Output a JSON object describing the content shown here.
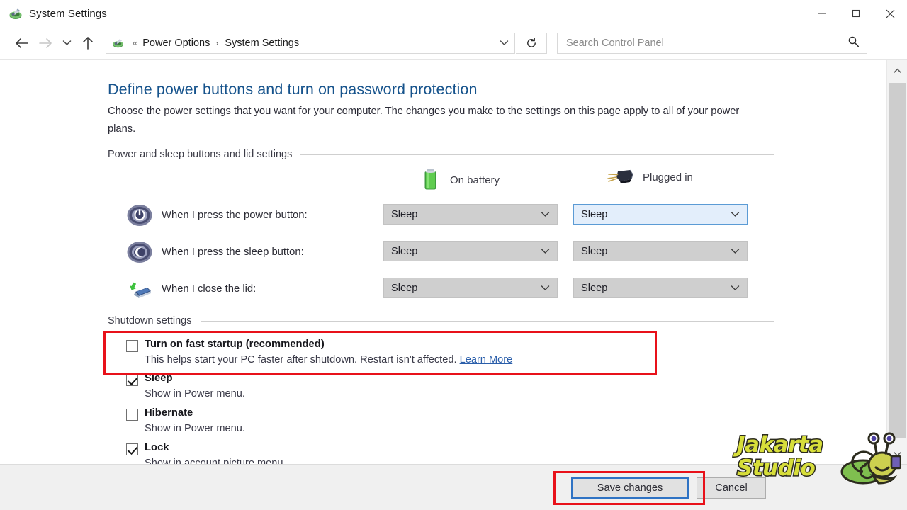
{
  "window": {
    "title": "System Settings",
    "icon": "power-options-icon",
    "controls": {
      "minimize": "minimize-icon",
      "maximize": "maximize-icon",
      "close": "close-icon"
    }
  },
  "navbar": {
    "back": "back-arrow-icon",
    "forward": "forward-arrow-icon",
    "history": "recent-locations-icon",
    "up": "up-arrow-icon",
    "address_icon": "power-options-icon",
    "overflow": "«",
    "breadcrumbs": [
      "Power Options",
      "System Settings"
    ],
    "separator": "›",
    "dropdown": "chevron-down-icon",
    "refresh": "refresh-icon",
    "search": {
      "placeholder": "Search Control Panel",
      "value": "",
      "icon": "search-icon"
    }
  },
  "page": {
    "title": "Define power buttons and turn on password protection",
    "description": "Choose the power settings that you want for your computer. The changes you make to the settings on this page apply to all of your power plans."
  },
  "sections": {
    "power_buttons": {
      "header": "Power and sleep buttons and lid settings",
      "columns": [
        {
          "label": "On battery",
          "icon": "battery-icon"
        },
        {
          "label": "Plugged in",
          "icon": "power-plug-icon"
        }
      ],
      "rows": [
        {
          "icon": "power-button-icon",
          "label": "When I press the power button:",
          "on_battery": "Sleep",
          "plugged_in": "Sleep",
          "plugged_in_focused": true
        },
        {
          "icon": "sleep-moon-icon",
          "label": "When I press the sleep button:",
          "on_battery": "Sleep",
          "plugged_in": "Sleep",
          "plugged_in_focused": false
        },
        {
          "icon": "laptop-lid-icon",
          "label": "When I close the lid:",
          "on_battery": "Sleep",
          "plugged_in": "Sleep",
          "plugged_in_focused": false
        }
      ]
    },
    "shutdown": {
      "header": "Shutdown settings",
      "items": [
        {
          "label": "Turn on fast startup (recommended)",
          "checked": false,
          "sub": "This helps start your PC faster after shutdown. Restart isn't affected. ",
          "link": "Learn More",
          "highlighted": true
        },
        {
          "label": "Sleep",
          "checked": true,
          "sub": "Show in Power menu.",
          "link": "",
          "highlighted": false
        },
        {
          "label": "Hibernate",
          "checked": false,
          "sub": "Show in Power menu.",
          "link": "",
          "highlighted": false
        },
        {
          "label": "Lock",
          "checked": true,
          "sub": "Show in account picture menu.",
          "link": "",
          "highlighted": false
        }
      ]
    }
  },
  "footer": {
    "save_label": "Save changes",
    "cancel_label": "Cancel",
    "save_highlighted": true
  },
  "scrollbar": {
    "up": "scroll-up-icon",
    "down": "scroll-down-icon"
  },
  "watermark": {
    "line1": "Jakarta",
    "line2": "Studio",
    "mascot": "snail-mascot-icon"
  },
  "colors": {
    "accent_title": "#16538c",
    "highlight_red": "#e8111a",
    "focus_blue": "#5b9bd5",
    "link_blue": "#2a5eaa",
    "combo_gray": "#cfcfcf"
  }
}
